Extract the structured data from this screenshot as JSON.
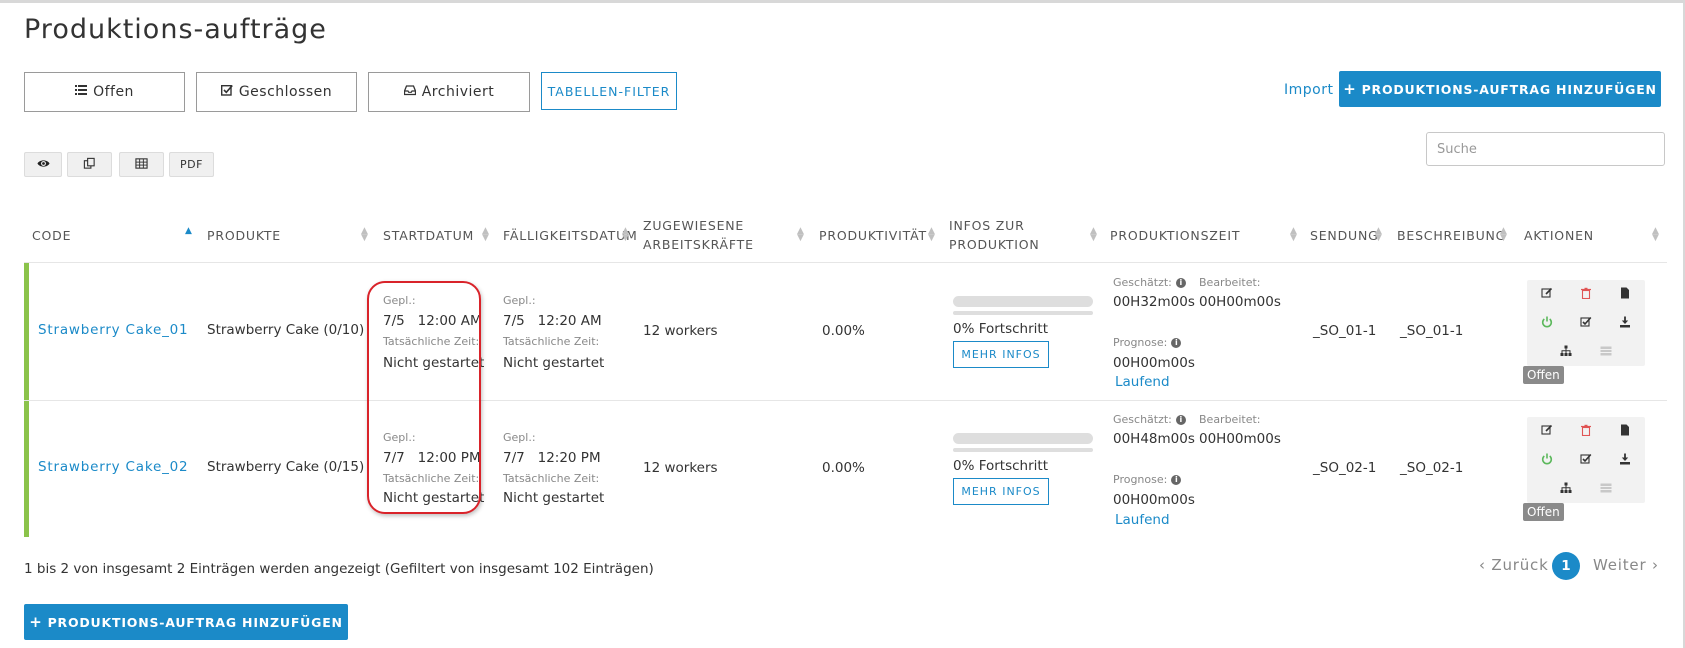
{
  "page": {
    "title": "Produktions-aufträge"
  },
  "tabs": [
    {
      "label": "Offen",
      "icon": "list-icon"
    },
    {
      "label": "Geschlossen",
      "icon": "check-square-icon"
    },
    {
      "label": "Archiviert",
      "icon": "inbox-icon"
    }
  ],
  "toolbar": {
    "filter_label": "TABELLEN-FILTER",
    "import_label": "Import",
    "add_label": "PRODUKTIONS-AUFTRAG HINZUFÜGEN",
    "pdf_label": "PDF",
    "search_placeholder": "Suche"
  },
  "table": {
    "headers": {
      "code": "CODE",
      "produkte": "PRODUKTE",
      "startdatum": "STARTDATUM",
      "faelligkeit": "FÄLLIGKEITSDATUM",
      "zugewiesene_1": "ZUGEWIESENE",
      "zugewiesene_2": "ARBEITSKRÄFTE",
      "produktivitaet": "PRODUKTIVITÄT",
      "infos_1": "INFOS ZUR",
      "infos_2": "PRODUKTION",
      "produktionszeit": "PRODUKTIONSZEIT",
      "sendung": "SENDUNG",
      "beschreibung": "BESCHREIBUNG",
      "aktionen": "AKTIONEN"
    },
    "labels": {
      "gepl": "Gepl.:",
      "tatsaechlich": "Tatsächliche Zeit:",
      "geschaetzt": "Geschätzt:",
      "bearbeitet": "Bearbeitet:",
      "prognose": "Prognose:",
      "mehr_infos": "MEHR INFOS"
    },
    "rows": [
      {
        "code": "Strawberry Cake_01",
        "product": "Strawberry Cake (0/10)",
        "start_date": "7/5",
        "start_time": "12:00 AM",
        "start_actual": "Nicht gestartet",
        "due_date": "7/5",
        "due_time": "12:20 AM",
        "due_actual": "Nicht gestartet",
        "workers": "12 workers",
        "productivity": "0.00%",
        "progress_pct": 0,
        "progress_text": "0% Fortschritt",
        "estimated": "00H32m00s",
        "processed": "00H00m00s",
        "forecast": "00H00m00s",
        "run_status": "Laufend",
        "shipment": "_SO_01-1",
        "description": "_SO_01-1",
        "status": "Offen"
      },
      {
        "code": "Strawberry Cake_02",
        "product": "Strawberry Cake (0/15)",
        "start_date": "7/7",
        "start_time": "12:00 PM",
        "start_actual": "Nicht gestartet",
        "due_date": "7/7",
        "due_time": "12:20 PM",
        "due_actual": "Nicht gestartet",
        "workers": "12 workers",
        "productivity": "0.00%",
        "progress_pct": 0,
        "progress_text": "0% Fortschritt",
        "estimated": "00H48m00s",
        "processed": "00H00m00s",
        "forecast": "00H00m00s",
        "run_status": "Laufend",
        "shipment": "_SO_02-1",
        "description": "_SO_02-1",
        "status": "Offen"
      }
    ]
  },
  "footer": {
    "info": "1 bis 2 von insgesamt 2 Einträgen werden angezeigt (Gefiltert von insgesamt 102 Einträgen)",
    "prev": "Zurück",
    "next": "Weiter",
    "page": "1"
  },
  "colors": {
    "accent": "#1b8ac8",
    "row_bar": "#8bc34a",
    "highlight": "#d9232a",
    "badge": "#8a8a8a"
  }
}
